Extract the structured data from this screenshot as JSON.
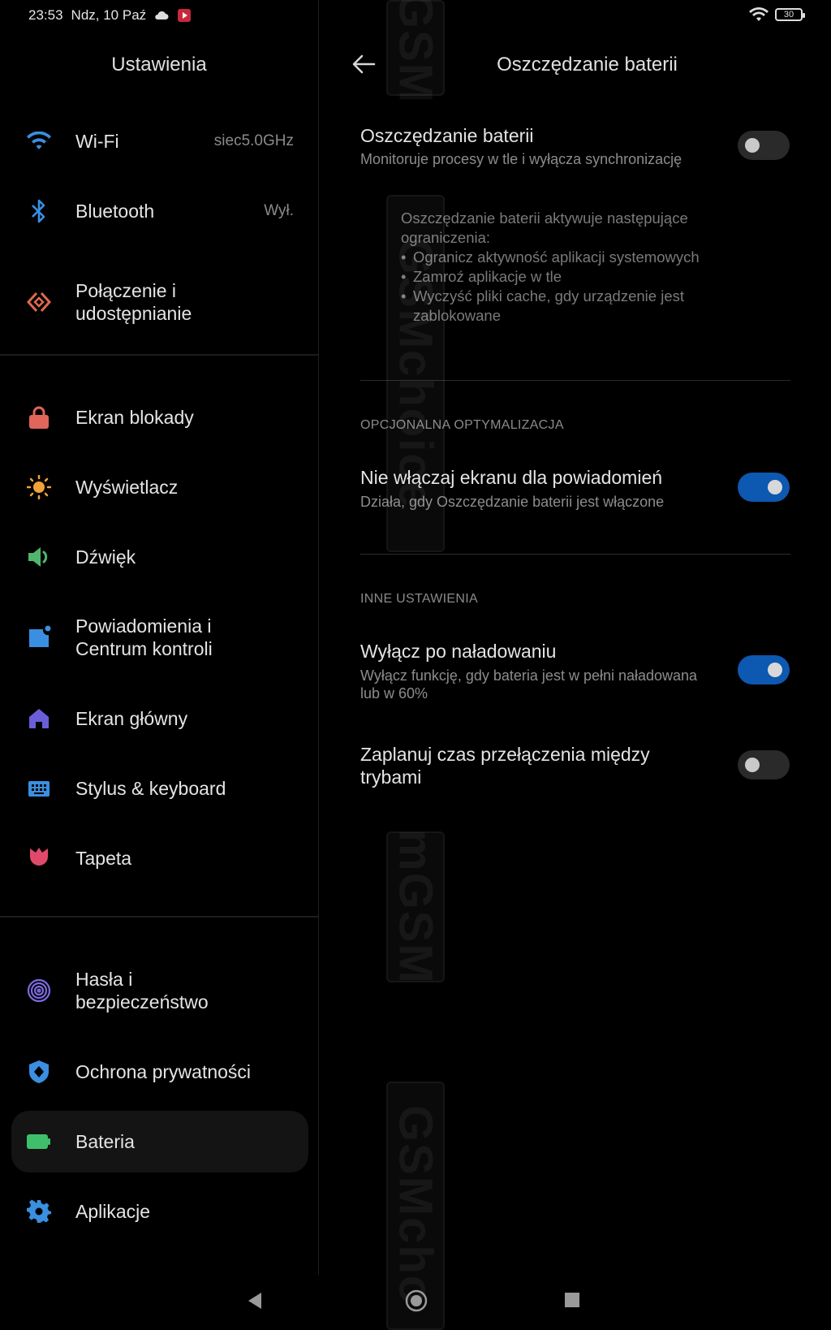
{
  "status_bar": {
    "time": "23:53",
    "date": "Ndz, 10 Paź",
    "battery": "30"
  },
  "left_panel": {
    "title": "Ustawienia",
    "items": [
      {
        "label": "Wi-Fi",
        "value": "siec5.0GHz",
        "icon": "wifi-icon"
      },
      {
        "label": "Bluetooth",
        "value": "Wył.",
        "icon": "bluetooth-icon"
      },
      {
        "label": "Połączenie i\nudostępnianie",
        "icon": "connection-sharing-icon"
      },
      {
        "label": "Ekran blokady",
        "icon": "lock-icon"
      },
      {
        "label": "Wyświetlacz",
        "icon": "sun-icon"
      },
      {
        "label": "Dźwięk",
        "icon": "speaker-icon"
      },
      {
        "label": "Powiadomienia i\nCentrum kontroli",
        "icon": "notification-icon"
      },
      {
        "label": "Ekran główny",
        "icon": "home-icon"
      },
      {
        "label": "Stylus & keyboard",
        "icon": "keyboard-icon"
      },
      {
        "label": "Tapeta",
        "icon": "tulip-icon"
      },
      {
        "label": "Hasła i\nbezpieczeństwo",
        "icon": "fingerprint-icon"
      },
      {
        "label": "Ochrona prywatności",
        "icon": "privacy-shield-icon"
      },
      {
        "label": "Bateria",
        "icon": "battery-icon"
      },
      {
        "label": "Aplikacje",
        "icon": "gear-icon"
      }
    ]
  },
  "right_panel": {
    "title": "Oszczędzanie baterii",
    "main_toggle": {
      "title": "Oszczędzanie baterii",
      "subtitle": "Monitoruje procesy w tle i wyłącza synchronizację",
      "enabled": false
    },
    "info": {
      "intro": "Oszczędzanie baterii aktywuje następujące ograniczenia:",
      "bullets": [
        "Ogranicz aktywność aplikacji systemowych",
        "Zamroź aplikacje w tle",
        "Wyczyść pliki cache, gdy urządzenie jest zablokowane"
      ]
    },
    "section_optional": "OPCJONALNA OPTYMALIZACJA",
    "screen_toggle": {
      "title": "Nie włączaj ekranu dla powiadomień",
      "subtitle": "Działa, gdy Oszczędzanie baterii jest włączone",
      "enabled": true
    },
    "section_other": "INNE USTAWIENIA",
    "charged_toggle": {
      "title": "Wyłącz po naładowaniu",
      "subtitle": "Wyłącz funkcję, gdy bateria jest w pełni naładowana lub w 60%",
      "enabled": true
    },
    "schedule_toggle": {
      "title": "Zaplanuj czas przełączenia między trybami",
      "enabled": false
    }
  },
  "watermark": [
    "GSM",
    "GSMchoice",
    "mGSM",
    "GSMcho"
  ],
  "colors": {
    "toggle_on": "#0d58b0",
    "background": "#000000"
  }
}
